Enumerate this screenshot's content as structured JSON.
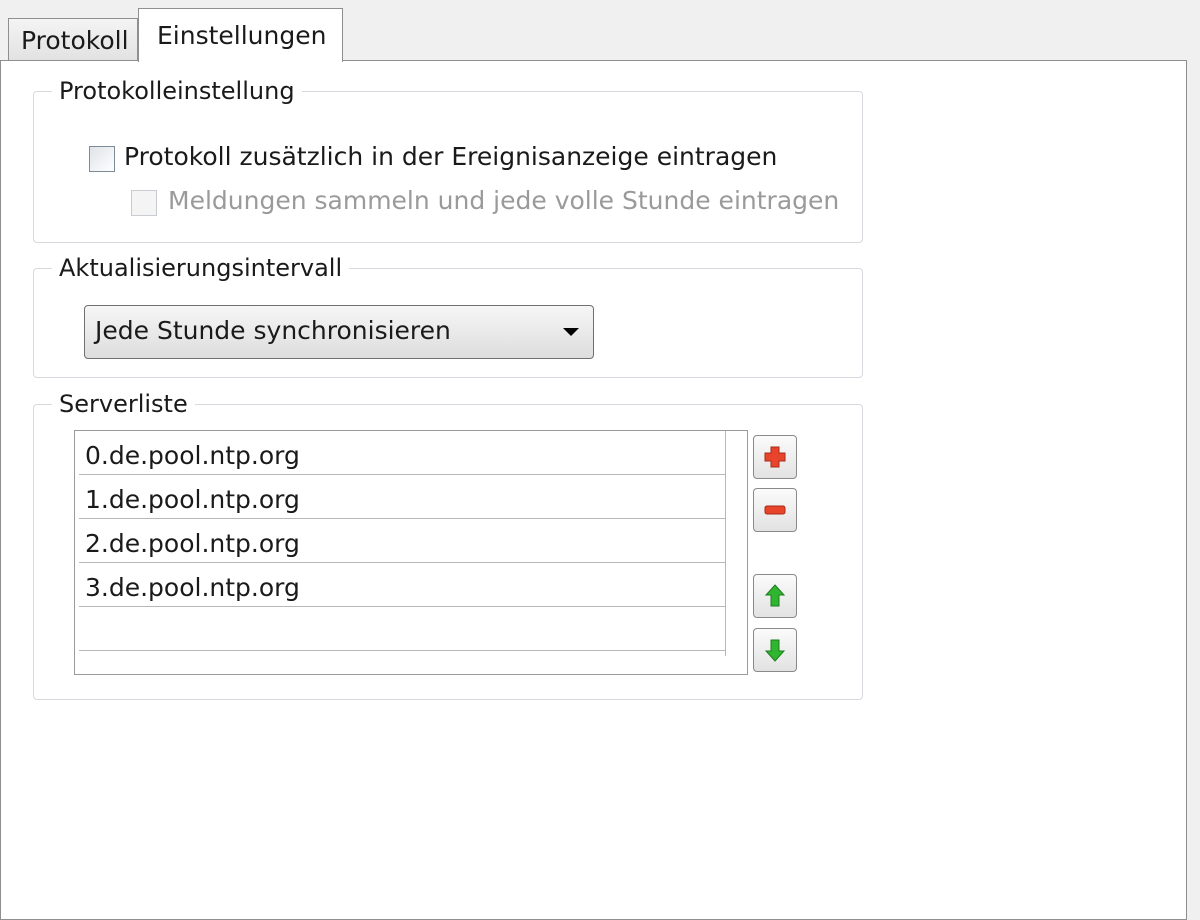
{
  "tabs": [
    {
      "label": "Protokoll",
      "active": false
    },
    {
      "label": "Einstellungen",
      "active": true
    }
  ],
  "protocol_group": {
    "title": "Protokolleinstellung",
    "checkbox_event_log": {
      "label": "Protokoll zusätzlich in der Ereignisanzeige eintragen",
      "checked": false,
      "enabled": true
    },
    "checkbox_hourly": {
      "label": "Meldungen sammeln und jede volle Stunde eintragen",
      "checked": false,
      "enabled": false
    }
  },
  "interval_group": {
    "title": "Aktualisierungsintervall",
    "selected": "Jede Stunde synchronisieren"
  },
  "server_group": {
    "title": "Serverliste",
    "servers": [
      "0.de.pool.ntp.org",
      "1.de.pool.ntp.org",
      "2.de.pool.ntp.org",
      "3.de.pool.ntp.org",
      ""
    ],
    "buttons": [
      {
        "icon": "plus-icon",
        "action": "add"
      },
      {
        "icon": "minus-icon",
        "action": "remove"
      },
      {
        "icon": "arrow-up-icon",
        "action": "move-up"
      },
      {
        "icon": "arrow-down-icon",
        "action": "move-down"
      }
    ]
  },
  "colors": {
    "add": "#e8442c",
    "remove": "#e8442c",
    "move": "#2fb52f"
  }
}
